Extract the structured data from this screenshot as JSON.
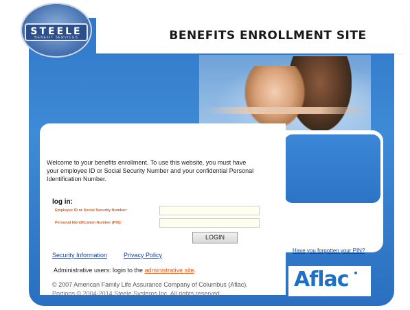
{
  "brand": {
    "logo_text": "STEELE",
    "logo_subtext": "BENEFIT SERVICES",
    "site_title": "BENEFITS ENROLLMENT SITE",
    "partner_logo_text": "Aflac"
  },
  "welcome": {
    "text": "Welcome to your benefits enrollment. To use this website, you must have your employee ID or Social Security Number and your confidential Personal Identification Number."
  },
  "login": {
    "heading": "log in:",
    "employee_id_label": "Employee ID or Social Security Number:",
    "employee_id_value": "",
    "pin_label": "Personal Identification Number (PIN):",
    "pin_value": "",
    "button_label": "LOGIN"
  },
  "links": {
    "security_information": "Security Information",
    "privacy_policy": "Privacy Policy",
    "forgot_pin": "Have you forgotten your PIN?"
  },
  "admin": {
    "prefix": "Administrative users: login to the",
    "link_text": "administrative site",
    "suffix": "."
  },
  "footer": {
    "copyright_line1": "© 2007 American Family Life Assurance Company of Columbus (Aflac).",
    "copyright_line2": "Portions © 2004-2014 Steele Systems Inc. All rights reserved."
  },
  "colors": {
    "brand_blue": "#2f78c8",
    "label_orange": "#e05a1c",
    "link_blue": "#1f3f8f",
    "aflac_blue": "#1e6fc6"
  }
}
